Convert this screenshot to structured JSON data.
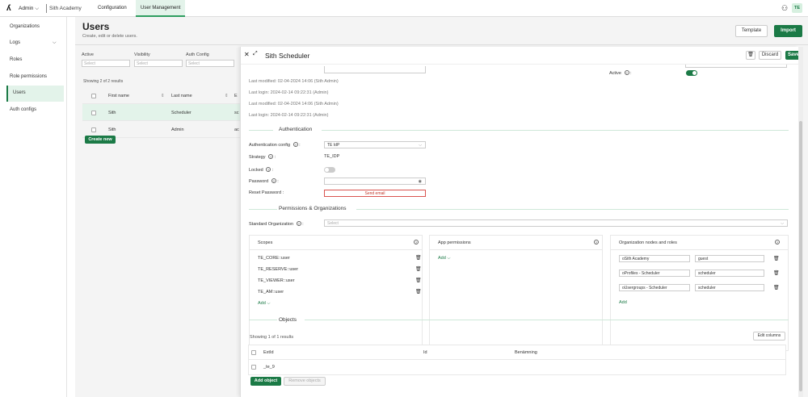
{
  "topbar": {
    "logo": "ʎ",
    "org_selector": "Admin",
    "app_name": "Sith Academy",
    "nav": [
      "Configuration",
      "User Management"
    ],
    "avatar": "TE"
  },
  "sidebar": {
    "items": [
      "Organizations",
      "Logs",
      "Roles",
      "Role permissions",
      "Users",
      "Auth configs"
    ]
  },
  "page": {
    "title": "Users",
    "subtitle": "Create, edit or delete users.",
    "template_btn": "Template",
    "import_btn": "Import"
  },
  "filters": {
    "labels": [
      "Active",
      "Visibility",
      "Auth Config"
    ],
    "placeholder": "Select"
  },
  "table": {
    "showing": "Showing 2 of 2 results",
    "headers": [
      "First name",
      "Last name",
      "E"
    ],
    "rows": [
      {
        "first": "Sith",
        "last": "Scheduler",
        "e": "sc"
      },
      {
        "first": "Sith",
        "last": "Admin",
        "e": "ac"
      }
    ],
    "create_new": "Create new"
  },
  "panel": {
    "title": "Sith Scheduler",
    "discard": "Discard",
    "save": "Save",
    "active_label": "Active",
    "meta": [
      "Last modified:  02-04-2024 14:06 (Sith Admin)",
      "Last login: 2024-02-14 09:22:31 (Admin)",
      "Last modified:  02-04-2024 14:06 (Sith Admin)",
      "Last login: 2024-02-14 09:22:31 (Admin)"
    ],
    "authentication": {
      "heading": "Authentication",
      "auth_config_label": "Authentication config",
      "auth_config_value": "TE IdP",
      "strategy_label": "Strategy",
      "strategy_value": "TE_IDP",
      "locked_label": "Locked",
      "password_label": "Password",
      "reset_label": "Reset Password",
      "send_email": "Send email"
    },
    "permissions": {
      "heading": "Permissions & Organizations",
      "std_org_label": "Standard Organization",
      "std_org_placeholder": "Select",
      "scopes_title": "Scopes",
      "scopes": [
        "TE_CORE::user",
        "TE_RESERVE::user",
        "TE_VIEWER::user",
        "TE_AM::user"
      ],
      "app_perm_title": "App permissions",
      "org_title": "Organization nodes and roles",
      "add": "Add",
      "orgs": [
        {
          "node": "oSith Academy",
          "role": "guest"
        },
        {
          "node": "oProfiles - Scheduler",
          "role": "scheduler"
        },
        {
          "node": "oUsergroups - Scheduler",
          "role": "scheduler"
        }
      ]
    },
    "objects": {
      "heading": "Objects",
      "showing": "Showing 1 of 1 results",
      "edit_columns": "Edit columns",
      "headers": [
        "ExtId",
        "Id",
        "Benämning"
      ],
      "rows": [
        {
          "extid": "_te_9",
          "id": "",
          "name": ""
        }
      ],
      "add_object": "Add object",
      "remove_objects": "Remove objects"
    }
  }
}
